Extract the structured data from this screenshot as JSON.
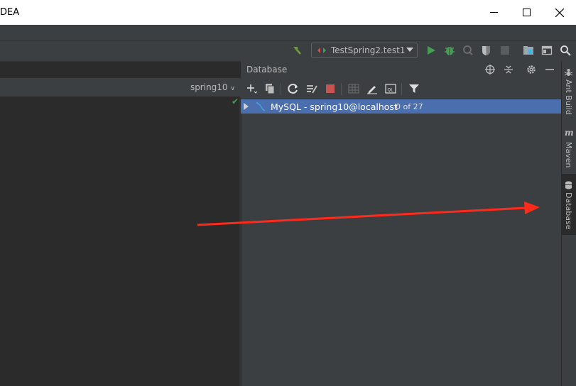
{
  "window": {
    "title": "DEA",
    "minimize_glyph": "—",
    "maximize_glyph": "☐",
    "close_glyph": "✕"
  },
  "toolbar": {
    "run_config": "TestSpring2.test1",
    "icons": [
      "hammer-icon",
      "run-icon",
      "debug-icon",
      "coverage-icon",
      "profile-icon",
      "stop-icon",
      "project-structure-icon",
      "layout-icon",
      "search-icon"
    ]
  },
  "editor": {
    "datasource_selector": "spring10",
    "check_glyph": "✔"
  },
  "database_panel": {
    "title": "Database",
    "header_icons": [
      "locate-icon",
      "collapse-icon",
      "settings-icon",
      "minimize-icon"
    ],
    "toolbar_icons": [
      "add-icon",
      "duplicate-icon",
      "refresh-icon",
      "sync-icon",
      "stop-icon",
      "table-icon",
      "edit-icon",
      "console-icon",
      "filter-icon"
    ],
    "tree": [
      {
        "label": "MySQL - spring10@localhost",
        "count": "0 of 27"
      }
    ]
  },
  "right_strip": {
    "tabs": [
      "Ant Build",
      "Maven",
      "Database"
    ]
  },
  "colors": {
    "selection": "#4b6eaf",
    "run_green": "#499c54",
    "stop_red": "#c75450",
    "arrow_red": "#ff2a1a"
  }
}
